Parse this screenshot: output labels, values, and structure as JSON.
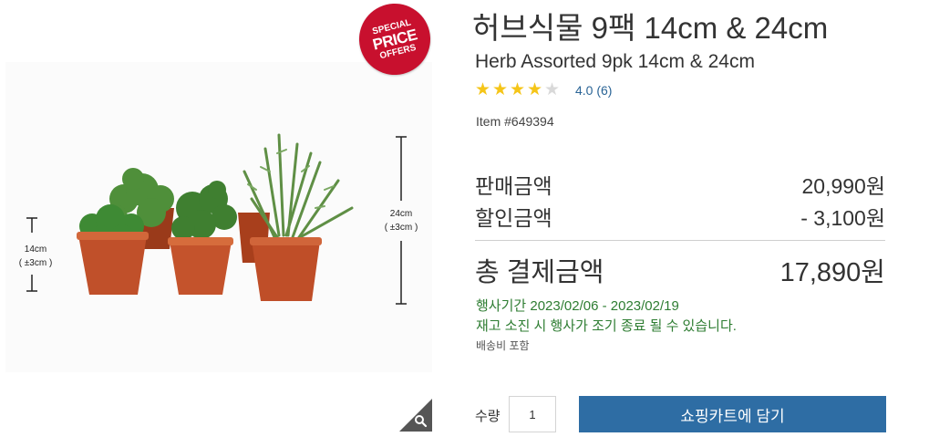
{
  "badge": {
    "line1": "SPECIAL",
    "line2": "PRICE",
    "line3": "OFFERS"
  },
  "image": {
    "small_dim": "14cm",
    "small_tol": "( ±3cm )",
    "large_dim": "24cm",
    "large_tol": "( ±3cm )",
    "zoom_icon": "magnifier-icon"
  },
  "product": {
    "title_ko": "허브식물 9팩 14cm & 24cm",
    "title_en": "Herb Assorted 9pk 14cm & 24cm",
    "rating_value": 4.0,
    "rating_text": "4.0 (6)",
    "stars": [
      "★",
      "★",
      "★",
      "★",
      "★"
    ],
    "item_number": "Item #649394"
  },
  "pricing": {
    "sale_label": "판매금액",
    "sale_value": "20,990원",
    "discount_label": "할인금액",
    "discount_value": "- 3,100원",
    "total_label": "총 결제금액",
    "total_value": "17,890원"
  },
  "promo": {
    "period": "행사기간 2023/02/06 - 2023/02/19",
    "notice": "재고 소진 시 행사가 조기 종료 될 수 있습니다.",
    "shipping": "배송비 포함"
  },
  "purchase": {
    "qty_label": "수량",
    "qty_value": "1",
    "cart_button": "쇼핑카트에 담기"
  },
  "colors": {
    "accent": "#2e6da4",
    "badge": "#c8102e",
    "star_on": "#f5c518",
    "star_off": "#d9d9d9",
    "promo_text": "#2e7d32",
    "rating_link": "#2a6496"
  }
}
